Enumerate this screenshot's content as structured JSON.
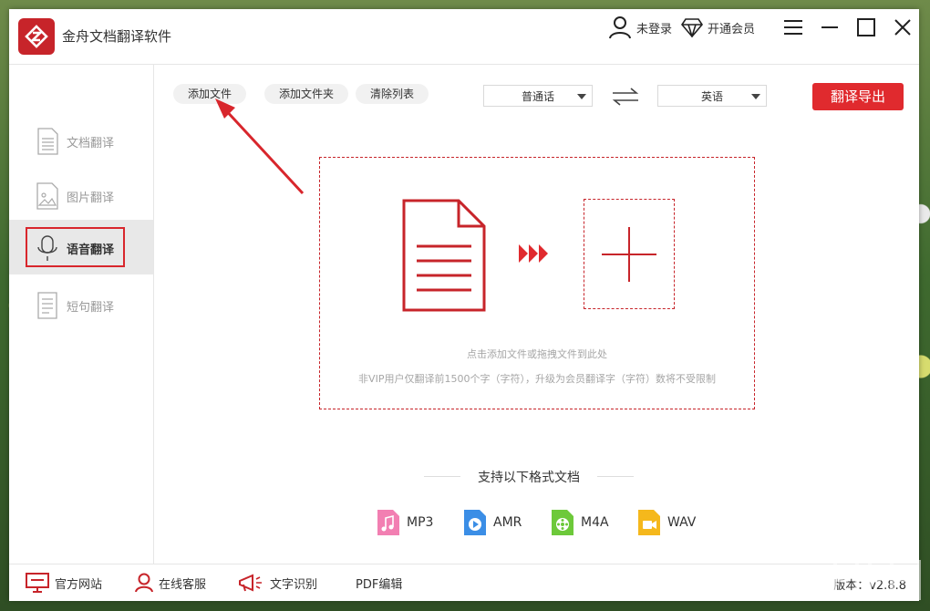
{
  "app": {
    "title": "金舟文档翻译软件"
  },
  "titlebar": {
    "login_label": "未登录",
    "vip_label": "开通会员"
  },
  "sidebar": {
    "items": [
      {
        "label": "文档翻译",
        "icon": "document-icon"
      },
      {
        "label": "图片翻译",
        "icon": "image-icon"
      },
      {
        "label": "语音翻译",
        "icon": "microphone-icon",
        "active": true
      },
      {
        "label": "短句翻译",
        "icon": "text-note-icon"
      }
    ]
  },
  "toolbar": {
    "add_file": "添加文件",
    "add_folder": "添加文件夹",
    "clear_list": "清除列表",
    "source_lang": "普通话",
    "target_lang": "英语",
    "translate_export": "翻译导出"
  },
  "dropzone": {
    "hint1": "点击添加文件或拖拽文件到此处",
    "hint2": "非VIP用户仅翻译前1500个字（字符），升级为会员翻译字（字符）数将不受限制"
  },
  "formats": {
    "title": "支持以下格式文档",
    "items": [
      {
        "label": "MP3",
        "color": "#f27fb2",
        "icon": "music-file-icon"
      },
      {
        "label": "AMR",
        "color": "#3b8ee6",
        "icon": "play-file-icon"
      },
      {
        "label": "M4A",
        "color": "#6dc93a",
        "icon": "film-file-icon"
      },
      {
        "label": "WAV",
        "color": "#f5b81c",
        "icon": "video-file-icon"
      }
    ]
  },
  "footer": {
    "website": "官方网站",
    "support": "在线客服",
    "ocr": "文字识别",
    "pdf": "PDF编辑",
    "version": "版本：v2.8.8"
  },
  "colors": {
    "accent": "#e02a2e",
    "brand": "#c7242a"
  }
}
